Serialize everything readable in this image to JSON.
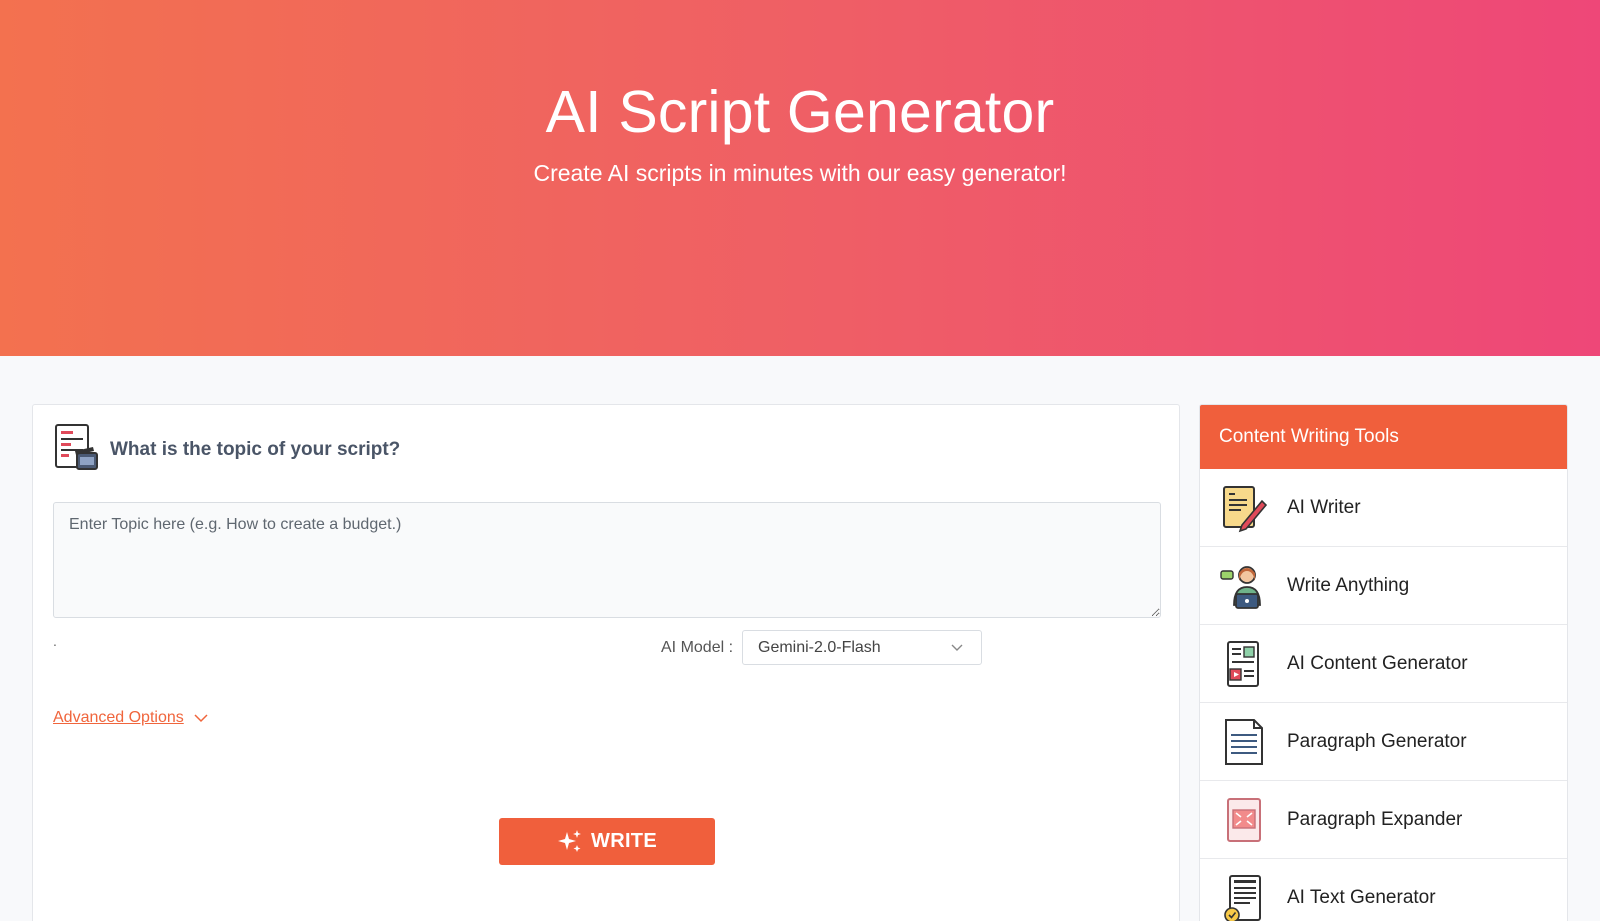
{
  "hero": {
    "title": "AI Script Generator",
    "subtitle": "Create AI scripts in minutes with our easy generator!"
  },
  "form": {
    "question": "What is the topic of your script?",
    "topic_placeholder": "Enter Topic here (e.g. How to create a budget.)",
    "topic_value": "",
    "dot": ".",
    "model_label": "AI Model :",
    "model_value": "Gemini-2.0-Flash",
    "advanced_label": "Advanced Options",
    "write_label": "WRITE"
  },
  "sidebar": {
    "title": "Content Writing Tools",
    "items": [
      {
        "label": "AI Writer",
        "icon": "ai-writer-icon"
      },
      {
        "label": "Write Anything",
        "icon": "write-anything-icon"
      },
      {
        "label": "AI Content Generator",
        "icon": "content-generator-icon"
      },
      {
        "label": "Paragraph Generator",
        "icon": "paragraph-generator-icon"
      },
      {
        "label": "Paragraph Expander",
        "icon": "paragraph-expander-icon"
      },
      {
        "label": "AI Text Generator",
        "icon": "text-generator-icon"
      }
    ]
  },
  "colors": {
    "accent": "#f05f3c",
    "gradient_start": "#f3714f",
    "gradient_end": "#ee4778"
  }
}
